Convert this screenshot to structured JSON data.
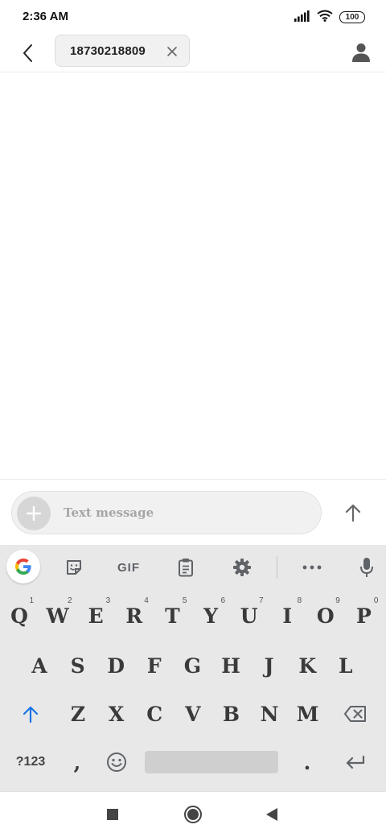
{
  "status_bar": {
    "time": "2:36 AM",
    "battery": "100",
    "icons": [
      "signal-icon",
      "wifi-icon",
      "battery-icon"
    ]
  },
  "header": {
    "back_icon": "back-arrow-icon",
    "recipient": "18730218809",
    "remove_icon": "close-icon",
    "contact_icon": "person-icon"
  },
  "compose": {
    "placeholder": "Text message",
    "attach_icon": "plus-icon",
    "send_icon": "send-arrow-icon"
  },
  "keyboard": {
    "toolbar": {
      "google": "google-icon",
      "sticker": "sticker-icon",
      "gif": "GIF",
      "clipboard": "clipboard-icon",
      "settings": "gear-icon",
      "more": "more-icon",
      "mic": "mic-icon"
    },
    "row1": [
      {
        "key": "Q",
        "hint": "1"
      },
      {
        "key": "W",
        "hint": "2"
      },
      {
        "key": "E",
        "hint": "3"
      },
      {
        "key": "R",
        "hint": "4"
      },
      {
        "key": "T",
        "hint": "5"
      },
      {
        "key": "Y",
        "hint": "6"
      },
      {
        "key": "U",
        "hint": "7"
      },
      {
        "key": "I",
        "hint": "8"
      },
      {
        "key": "O",
        "hint": "9"
      },
      {
        "key": "P",
        "hint": "0"
      }
    ],
    "row2": [
      "A",
      "S",
      "D",
      "F",
      "G",
      "H",
      "J",
      "K",
      "L"
    ],
    "row3": [
      "Z",
      "X",
      "C",
      "V",
      "B",
      "N",
      "M"
    ],
    "symbols_key": "?123",
    "comma_key": ",",
    "period_key": ".",
    "shift_icon": "shift-arrow-icon",
    "backspace_icon": "backspace-icon",
    "emoji_icon": "emoji-icon",
    "enter_icon": "enter-icon"
  },
  "nav_bar": {
    "recents_icon": "square-icon",
    "home_icon": "circle-icon",
    "back_icon": "triangle-back-icon"
  },
  "colors": {
    "accent": "#1a73e8",
    "keyboard_bg": "#e8e8e8",
    "key_text": "#3a3a3a",
    "placeholder": "#a6a6a6"
  }
}
